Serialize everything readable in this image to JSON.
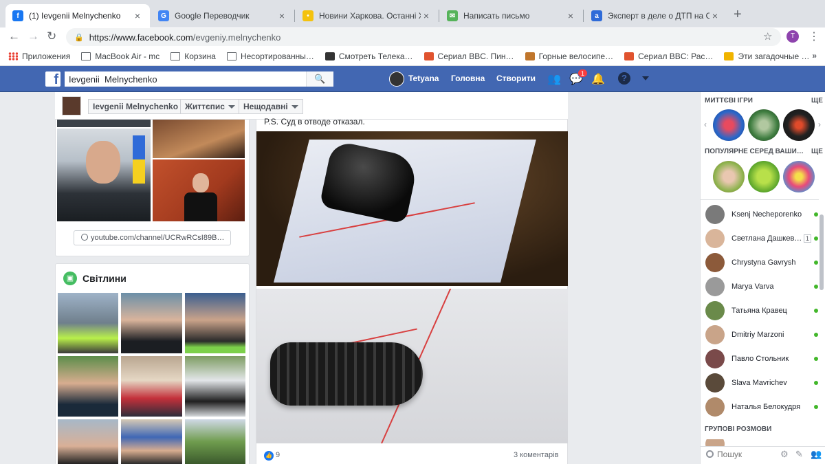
{
  "browser": {
    "tabs": [
      {
        "title": "(1) Ievgenii Melnychenko",
        "favicon": "facebook-icon",
        "color": "#1877f2",
        "glyph": "f"
      },
      {
        "title": "Google Переводчик",
        "favicon": "google-translate-icon",
        "color": "#4285f4",
        "glyph": "G"
      },
      {
        "title": "Новини Харкова. Останні Хар",
        "favicon": "news-icon",
        "color": "#f4c20d",
        "glyph": "•"
      },
      {
        "title": "Написать письмо",
        "favicon": "mail-icon",
        "color": "#56b35a",
        "glyph": "✉"
      },
      {
        "title": "Эксперт в деле о ДТП на Сум",
        "favicon": "site-icon",
        "color": "#2f6bd8",
        "glyph": "a"
      }
    ],
    "url_host": "https://www.facebook.com",
    "url_path": "/evgeniy.melnychenko",
    "profile_initial": "T",
    "bookmarks": [
      {
        "label": "Приложения",
        "icon": "apps-icon"
      },
      {
        "label": "MacBook Air - mc",
        "icon": "folder-icon"
      },
      {
        "label": "Корзина",
        "icon": "folder-icon"
      },
      {
        "label": "Несортированны…",
        "icon": "folder-icon"
      },
      {
        "label": "Смотреть Телека…",
        "icon": "tv-icon"
      },
      {
        "label": "Сериал BBC. Пин…",
        "icon": "site-icon"
      },
      {
        "label": "Горные велосипе…",
        "icon": "site-icon"
      },
      {
        "label": "Сериал BBC: Рас…",
        "icon": "site-icon"
      },
      {
        "label": "Эти загадочные …",
        "icon": "site-icon"
      }
    ],
    "bookmarks_more": "»"
  },
  "fb": {
    "search_value": "Ievgenii  Melnychenko",
    "user": "Tetyana",
    "nav_home": "Головна",
    "nav_create": "Створити",
    "messenger_badge": "1",
    "accent": "#4267b2"
  },
  "profile_bar": {
    "name": "Ievgenii Melnychenko",
    "timeline": "Життєпис",
    "recent": "Нещодавні"
  },
  "intro": {
    "link": "youtube.com/channel/UCRwRCsI89B…"
  },
  "photos": {
    "title": "Світлини"
  },
  "post": {
    "caption": "P.S. Суд в отводе отказал.",
    "likes": "9",
    "comments": "3 коментарів"
  },
  "sidebar": {
    "games_title": "МИТТЄВІ ІГРИ",
    "popular_title": "ПОПУЛЯРНЕ СЕРЕД ВАШИ…",
    "more": "ЩЕ",
    "group_title": "ГРУПОВІ РОЗМОВИ",
    "search_placeholder": "Пошук",
    "contacts": [
      {
        "name": "Ksenj Necheporenko",
        "count": ""
      },
      {
        "name": "Светлана Дашкев…",
        "count": "1"
      },
      {
        "name": "Chrystyna Gavrysh",
        "count": ""
      },
      {
        "name": "Marya Varva",
        "count": ""
      },
      {
        "name": "Татьяна Кравец",
        "count": ""
      },
      {
        "name": "Dmitriy Marzoni",
        "count": ""
      },
      {
        "name": "Павло Стольник",
        "count": ""
      },
      {
        "name": "Slava Mavrichev",
        "count": ""
      },
      {
        "name": "Наталья Белокудря",
        "count": ""
      }
    ]
  }
}
